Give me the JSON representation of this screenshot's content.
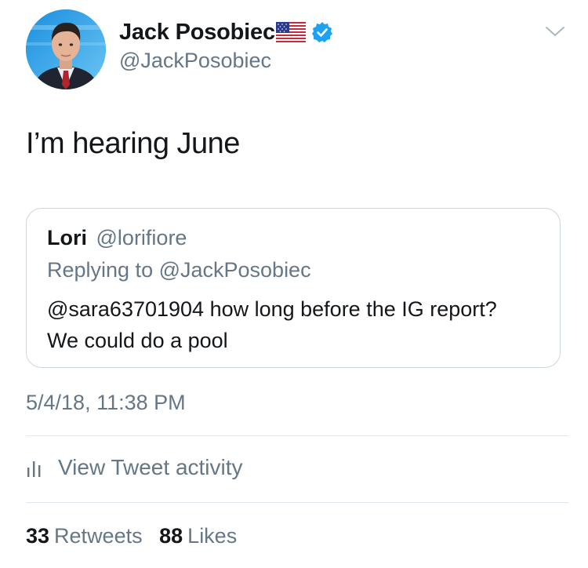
{
  "author": {
    "name": "Jack Posobiec",
    "handle": "@JackPosobiec",
    "name_emoji": "us-flag-icon",
    "verified_icon": "verified-badge-icon"
  },
  "tweet": {
    "text": "I’m hearing June",
    "timestamp": "5/4/18, 11:38 PM"
  },
  "quoted_tweet": {
    "name": "Lori",
    "handle": "@lorifiore",
    "replying_to": "Replying to @JackPosobiec",
    "text": "@sara63701904 how long before the IG report? We could do a pool"
  },
  "activity": {
    "label": "View Tweet activity",
    "icon": "bar-chart-icon"
  },
  "stats": {
    "retweets_count": "33",
    "retweets_label": "Retweets",
    "likes_count": "88",
    "likes_label": "Likes"
  },
  "menu": {
    "icon": "chevron-down-icon"
  },
  "colors": {
    "primary_text": "#14171a",
    "secondary_text": "#657786",
    "border": "#ccd6dd",
    "verified": "#1da1f2"
  }
}
